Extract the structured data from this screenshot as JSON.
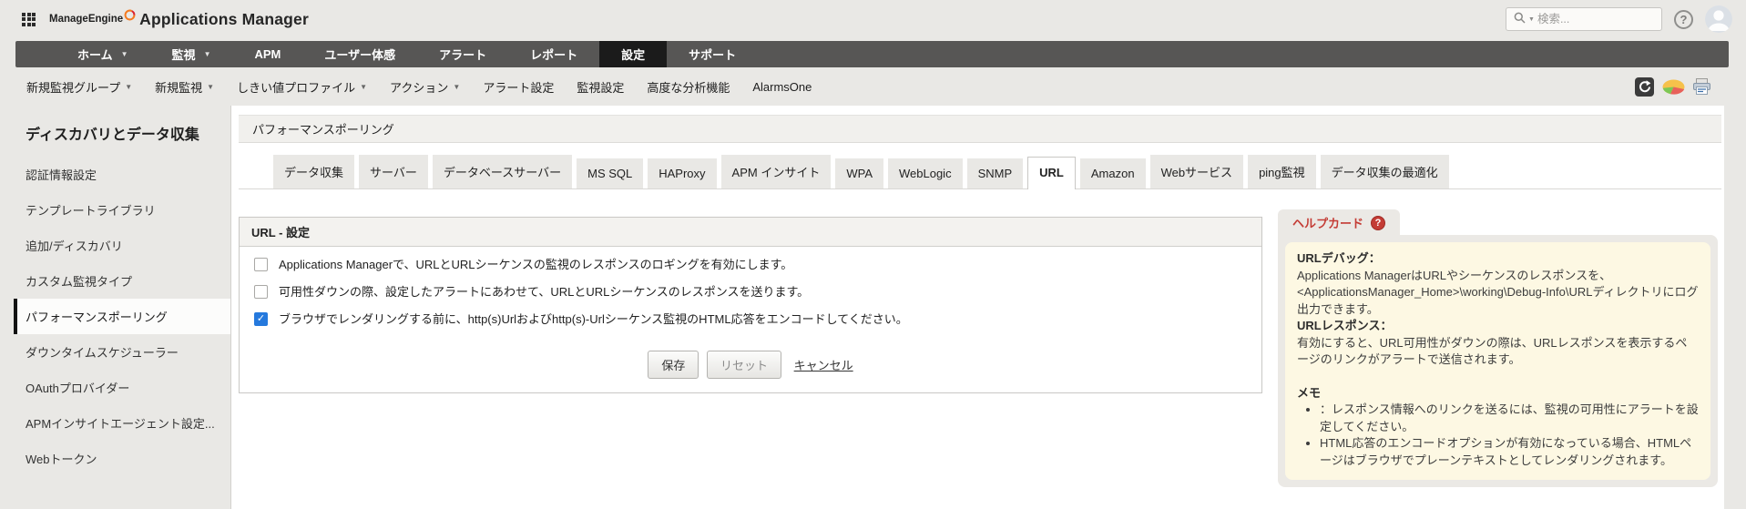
{
  "colors": {
    "navbar_bg": "#575655",
    "navbar_active_bg": "#1b1b1b",
    "accent_blue": "#2579dd",
    "help_red": "#c43c35",
    "note_bg": "#fdf8e3"
  },
  "topbar": {
    "brand": "ManageEngine",
    "product": "Applications Manager",
    "search": {
      "placeholder": "検索..."
    },
    "help_glyph": "?"
  },
  "navbar": {
    "items": [
      {
        "label": "ホーム",
        "dropdown": true,
        "active": false
      },
      {
        "label": "監視",
        "dropdown": true,
        "active": false
      },
      {
        "label": "APM",
        "dropdown": false,
        "active": false
      },
      {
        "label": "ユーザー体感",
        "dropdown": false,
        "active": false
      },
      {
        "label": "アラート",
        "dropdown": false,
        "active": false
      },
      {
        "label": "レポート",
        "dropdown": false,
        "active": false
      },
      {
        "label": "設定",
        "dropdown": false,
        "active": true
      },
      {
        "label": "サポート",
        "dropdown": false,
        "active": false
      }
    ]
  },
  "subnav": {
    "items": [
      {
        "label": "新規監視グループ",
        "dropdown": true
      },
      {
        "label": "新規監視",
        "dropdown": true
      },
      {
        "label": "しきい値プロファイル",
        "dropdown": true
      },
      {
        "label": "アクション",
        "dropdown": true
      },
      {
        "label": "アラート設定",
        "dropdown": false
      },
      {
        "label": "監視設定",
        "dropdown": false
      },
      {
        "label": "高度な分析機能",
        "dropdown": false
      },
      {
        "label": "AlarmsOne",
        "dropdown": false
      }
    ],
    "icons": [
      "refresh-icon",
      "pie-chart-icon",
      "printer-icon"
    ]
  },
  "sidebar": {
    "title": "ディスカバリとデータ収集",
    "items": [
      {
        "label": "認証情報設定",
        "active": false
      },
      {
        "label": "テンプレートライブラリ",
        "active": false
      },
      {
        "label": "追加/ディスカバリ",
        "active": false
      },
      {
        "label": "カスタム監視タイプ",
        "active": false
      },
      {
        "label": "パフォーマンスポーリング",
        "active": true
      },
      {
        "label": "ダウンタイムスケジューラー",
        "active": false
      },
      {
        "label": "OAuthプロバイダー",
        "active": false
      },
      {
        "label": "APMインサイトエージェント設定...",
        "active": false
      },
      {
        "label": "Webトークン",
        "active": false
      }
    ]
  },
  "main": {
    "page_title": "パフォーマンスポーリング",
    "tabs": [
      {
        "label": "データ収集",
        "active": false
      },
      {
        "label": "サーバー",
        "active": false
      },
      {
        "label": "データベースサーバー",
        "active": false
      },
      {
        "label": "MS SQL",
        "active": false
      },
      {
        "label": "HAProxy",
        "active": false
      },
      {
        "label": "APM インサイト",
        "active": false
      },
      {
        "label": "WPA",
        "active": false
      },
      {
        "label": "WebLogic",
        "active": false
      },
      {
        "label": "SNMP",
        "active": false
      },
      {
        "label": "URL",
        "active": true
      },
      {
        "label": "Amazon",
        "active": false
      },
      {
        "label": "Webサービス",
        "active": false
      },
      {
        "label": "ping監視",
        "active": false
      },
      {
        "label": "データ収集の最適化",
        "active": false
      }
    ],
    "settings": {
      "title": "URL - 設定",
      "options": [
        {
          "label": "Applications Managerで、URLとURLシーケンスの監視のレスポンスのロギングを有効にします。",
          "checked": false
        },
        {
          "label": "可用性ダウンの際、設定したアラートにあわせて、URLとURLシーケンスのレスポンスを送ります。",
          "checked": false
        },
        {
          "label": "ブラウザでレンダリングする前に、http(s)Urlおよびhttp(s)-Urlシーケンス監視のHTML応答をエンコードしてください。",
          "checked": true
        }
      ],
      "save_label": "保存",
      "reset_label": "リセット",
      "cancel_label": "キャンセル"
    }
  },
  "help": {
    "title": "ヘルプカード",
    "badge_glyph": "?",
    "sections": [
      {
        "heading": "URLデバッグ：",
        "body": "Applications ManagerはURLやシーケンスのレスポンスを、<ApplicationsManager_Home>\\working\\Debug-Info\\URLディレクトリにログ出力できます。"
      },
      {
        "heading": "URLレスポンス：",
        "body": "有効にすると、URL可用性がダウンの際は、URLレスポンスを表示するページのリンクがアラートで送信されます。"
      }
    ],
    "note": {
      "heading": "メモ",
      "bullets": [
        "：レスポンス情報へのリンクを送るには、監視の可用性にアラートを設定してください。",
        "HTML応答のエンコードオプションが有効になっている場合、HTMLページはブラウザでプレーンテキストとしてレンダリングされます。"
      ]
    }
  }
}
